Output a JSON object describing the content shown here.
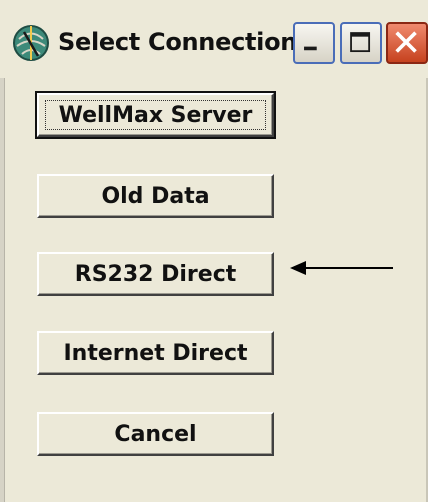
{
  "window": {
    "title": "Select Connection",
    "controls": {
      "minimize_icon": "minimize-icon",
      "maximize_icon": "maximize-icon",
      "close_icon": "close-icon"
    }
  },
  "buttons": [
    {
      "label": "WellMax Server",
      "default": true
    },
    {
      "label": "Old Data"
    },
    {
      "label": "RS232 Direct"
    },
    {
      "label": "Internet Direct"
    },
    {
      "label": "Cancel"
    }
  ],
  "annotation": {
    "icon": "left-arrow-icon",
    "points_to_button": 2
  },
  "colors": {
    "dialog_background": "#ece9d8",
    "close_button": "#c6421f",
    "control_border": "#4a6db8"
  }
}
